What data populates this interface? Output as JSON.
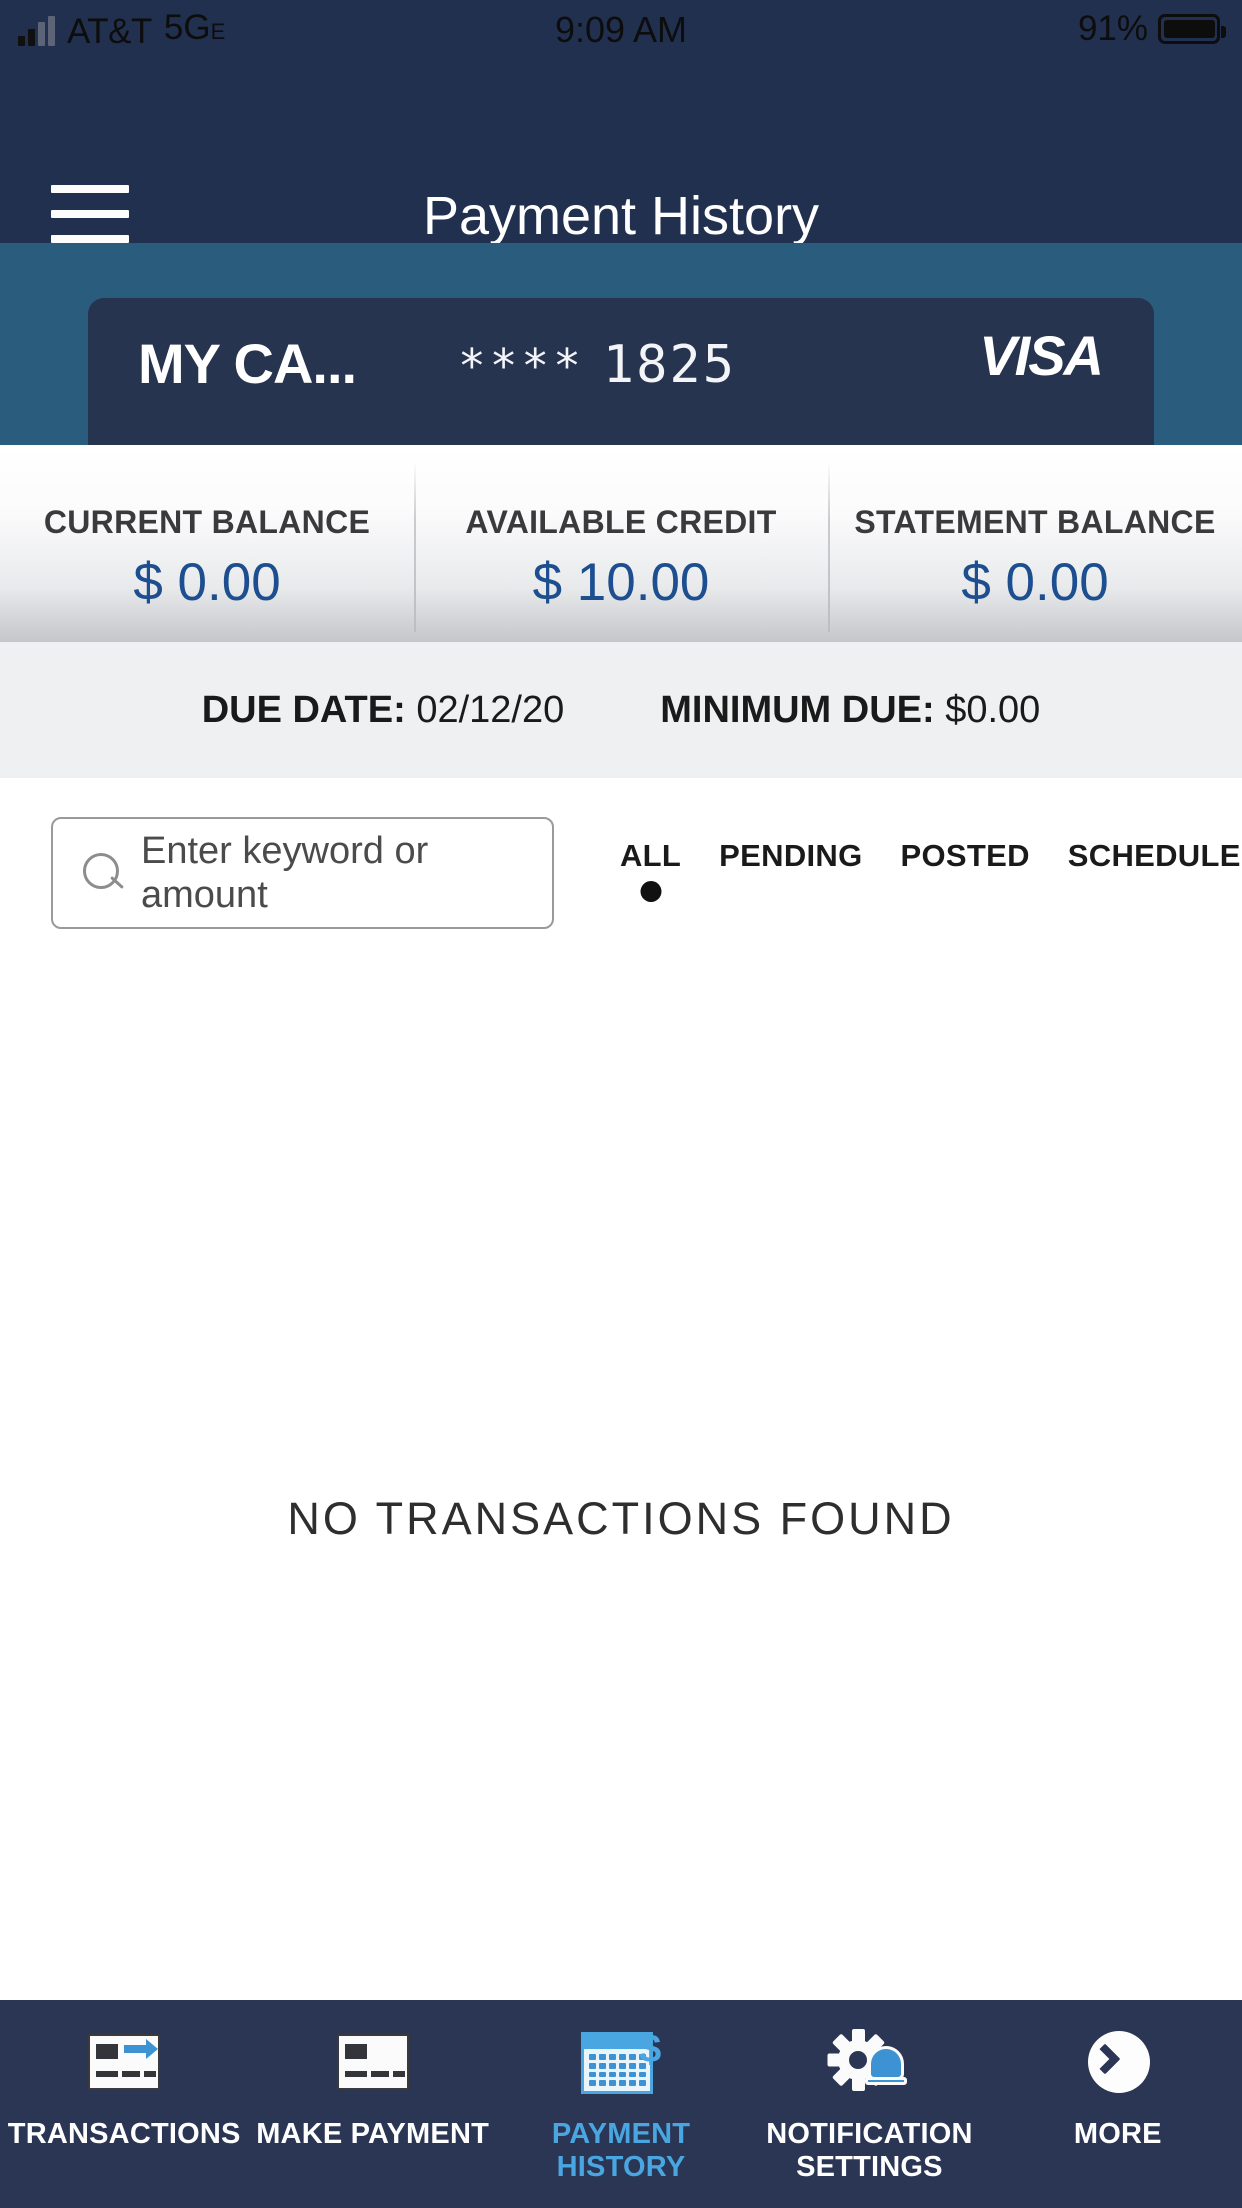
{
  "status_bar": {
    "carrier": "AT&T",
    "network": "5G",
    "network_sub": "E",
    "time": "9:09 AM",
    "battery_percent": "91%"
  },
  "header": {
    "title": "Payment History",
    "menu_icon": "hamburger-icon",
    "background": "#22304f"
  },
  "card": {
    "name": "MY CA...",
    "mask": "****",
    "last4": "1825",
    "brand": "VISA",
    "background": "#27344f",
    "band_background": "#2a5c7d",
    "swoosh_color": "#b5352a"
  },
  "balances": [
    {
      "label": "CURRENT BALANCE",
      "value": "$ 0.00"
    },
    {
      "label": "AVAILABLE CREDIT",
      "value": "$ 10.00"
    },
    {
      "label": "STATEMENT BALANCE",
      "value": "$ 0.00"
    }
  ],
  "balance_value_color": "#1d4e8f",
  "due": {
    "date_label": "DUE DATE:",
    "date_value": "02/12/20",
    "minimum_label": "MINIMUM DUE:",
    "minimum_value": "$0.00"
  },
  "search": {
    "placeholder": "Enter keyword or amount",
    "value": "",
    "icon": "search-icon"
  },
  "filters": {
    "items": [
      {
        "label": "ALL",
        "active": true
      },
      {
        "label": "PENDING",
        "active": false
      },
      {
        "label": "POSTED",
        "active": false
      },
      {
        "label": "SCHEDULED",
        "active": false
      }
    ],
    "active_index": 0
  },
  "empty_state": {
    "message": "NO TRANSACTIONS FOUND"
  },
  "bottom_nav": {
    "background": "#2b3655",
    "active_color": "#49a6e0",
    "items": [
      {
        "label": "TRANSACTIONS",
        "icon": "card-arrow-icon",
        "active": false
      },
      {
        "label": "MAKE PAYMENT",
        "icon": "card-icon",
        "active": false
      },
      {
        "label": "PAYMENT\nHISTORY",
        "icon": "calendar-dollar-icon",
        "active": true,
        "line1": "PAYMENT",
        "line2": "HISTORY"
      },
      {
        "label": "NOTIFICATION\nSETTINGS",
        "icon": "gear-bell-icon",
        "active": false,
        "line1": "NOTIFICATION",
        "line2": "SETTINGS"
      },
      {
        "label": "MORE",
        "icon": "chevron-right-circle-icon",
        "active": false
      }
    ]
  }
}
